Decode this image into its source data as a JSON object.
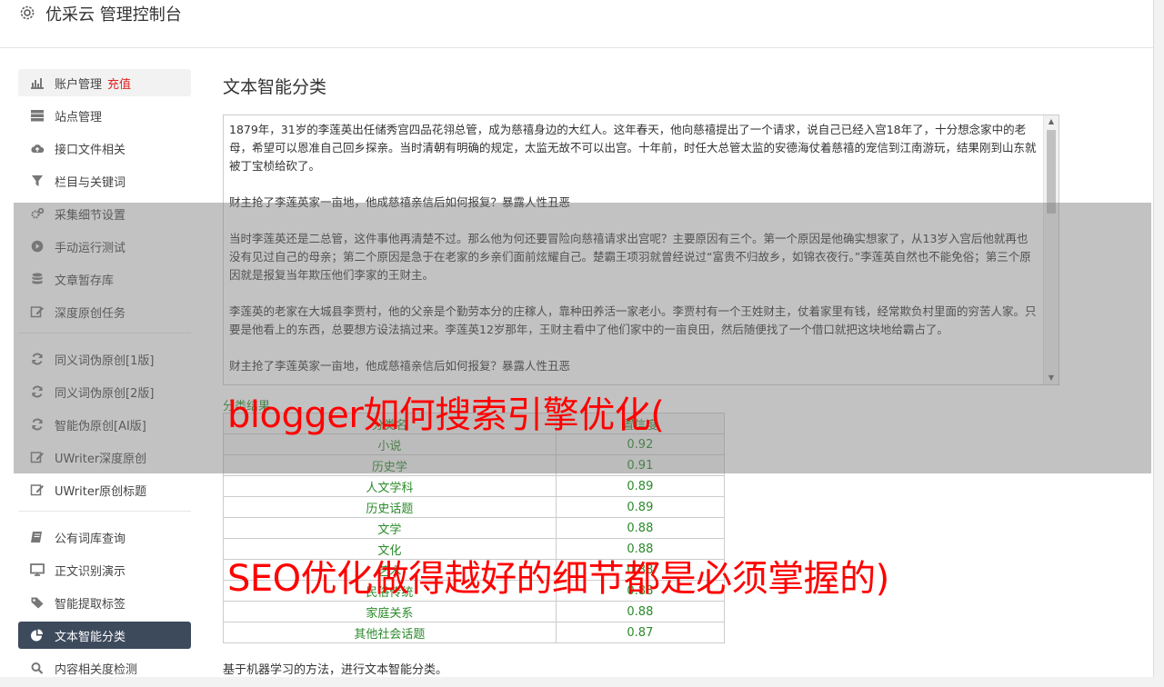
{
  "header": {
    "title": "优采云 管理控制台"
  },
  "sidebar": {
    "group1": [
      {
        "label": "账户管理",
        "extra": "充值",
        "icon": "bar-chart-icon"
      },
      {
        "label": "站点管理",
        "icon": "server-icon"
      },
      {
        "label": "接口文件相关",
        "icon": "cloud-upload-icon"
      },
      {
        "label": "栏目与关键词",
        "icon": "filter-icon"
      },
      {
        "label": "采集细节设置",
        "icon": "gears-icon"
      },
      {
        "label": "手动运行测试",
        "icon": "play-circle-icon"
      },
      {
        "label": "文章暂存库",
        "icon": "database-icon"
      },
      {
        "label": "深度原创任务",
        "icon": "edit-icon"
      }
    ],
    "group2": [
      {
        "label": "同义词伪原创[1版]",
        "icon": "refresh-icon"
      },
      {
        "label": "同义词伪原创[2版]",
        "icon": "refresh-icon"
      },
      {
        "label": "智能伪原创[AI版]",
        "icon": "refresh-icon"
      },
      {
        "label": "UWriter深度原创",
        "icon": "edit-icon"
      },
      {
        "label": "UWriter原创标题",
        "icon": "edit-icon"
      }
    ],
    "group3": [
      {
        "label": "公有词库查询",
        "icon": "book-icon"
      },
      {
        "label": "正文识别演示",
        "icon": "monitor-icon"
      },
      {
        "label": "智能提取标签",
        "icon": "tag-icon"
      },
      {
        "label": "文本智能分类",
        "icon": "pie-chart-icon"
      },
      {
        "label": "内容相关度检测",
        "icon": "search-icon"
      }
    ]
  },
  "main": {
    "title": "文本智能分类",
    "article": [
      "1879年，31岁的李莲英出任储秀宫四品花翎总管，成为慈禧身边的大红人。这年春天，他向慈禧提出了一个请求，说自己已经入宫18年了，十分想念家中的老母，希望可以恩准自己回乡探亲。当时清朝有明确的规定，太监无故不可以出宫。十年前，时任大总管太监的安德海仗着慈禧的宠信到江南游玩，结果刚到山东就被丁宝桢给砍了。",
      "财主抢了李莲英家一亩地，他成慈禧亲信后如何报复？暴露人性丑恶",
      "当时李莲英还是二总管，这件事他再清楚不过。那么他为何还要冒险向慈禧请求出宫呢？主要原因有三个。第一个原因是他确实想家了，从13岁入宫后他就再也没有见过自己的母亲；第二个原因是急于在老家的乡亲们面前炫耀自己。楚霸王项羽就曾经说过“富贵不归故乡，如锦衣夜行。”李莲英自然也不能免俗；第三个原因就是报复当年欺压他们李家的王财主。",
      "李莲英的老家在大城县李贾村，他的父亲是个勤劳本分的庄稼人，靠种田养活一家老小。李贾村有一个王姓财主，仗着家里有钱，经常欺负村里面的穷苦人家。只要是他看上的东西，总要想方设法搞过来。李莲英12岁那年，王财主看中了他们家中的一亩良田，然后随便找了一个借口就把这块地给霸占了。",
      "财主抢了李莲英家一亩地，他成慈禧亲信后如何报复？暴露人性丑恶"
    ],
    "result_label": "分类结果",
    "table": {
      "headers": [
        "分类名",
        "置信度"
      ],
      "rows": [
        [
          "小说",
          "0.92"
        ],
        [
          "历史学",
          "0.91"
        ],
        [
          "人文学科",
          "0.89"
        ],
        [
          "历史话题",
          "0.89"
        ],
        [
          "文学",
          "0.88"
        ],
        [
          "文化",
          "0.88"
        ],
        [
          "艺术",
          "0.88"
        ],
        [
          "民俗传统",
          "0.88"
        ],
        [
          "家庭关系",
          "0.88"
        ],
        [
          "其他社会话题",
          "0.87"
        ]
      ]
    },
    "footnote": "基于机器学习的方法，进行文本智能分类。"
  },
  "overlay": {
    "line1": "blogger如何搜索引擎优化(",
    "line2": "SEO优化做得越好的细节都是必须掌握的)"
  },
  "colors": {
    "active_nav": "#3d4a5c",
    "green": "#2a8a2a",
    "overlay_red": "#ff0000"
  }
}
